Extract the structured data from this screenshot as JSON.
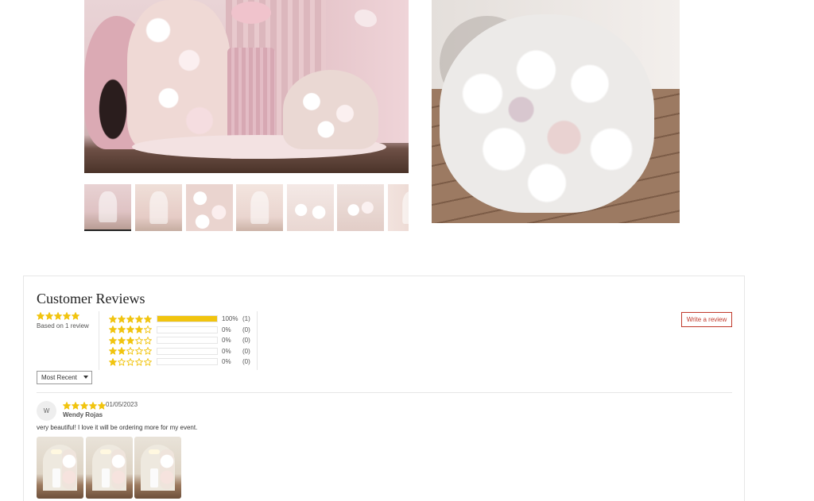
{
  "gallery": {
    "next_icon": "chevron-right-icon",
    "thumbnail_count": 7,
    "active_thumbnail": 1
  },
  "reviews": {
    "title": "Customer Reviews",
    "average_rating": 5,
    "based_on": "Based on 1 review",
    "star_color": "#f1c40f",
    "accent_color": "#c0392b",
    "histogram": [
      {
        "stars": 5,
        "fraction": 1.0,
        "percent": "100%",
        "count": "(1)"
      },
      {
        "stars": 4,
        "fraction": 0.0,
        "percent": "0%",
        "count": "(0)"
      },
      {
        "stars": 3,
        "fraction": 0.0,
        "percent": "0%",
        "count": "(0)"
      },
      {
        "stars": 2,
        "fraction": 0.0,
        "percent": "0%",
        "count": "(0)"
      },
      {
        "stars": 1,
        "fraction": 0.0,
        "percent": "0%",
        "count": "(0)"
      }
    ],
    "write_review_label": "Write a review",
    "sort": {
      "selected": "Most Recent"
    },
    "items": [
      {
        "avatar_initial": "W",
        "rating": 5,
        "date": "01/05/2023",
        "author": "Wendy Rojas",
        "body": "very beautiful! I love it will be ordering more for my event.",
        "photo_count": 3
      }
    ]
  }
}
